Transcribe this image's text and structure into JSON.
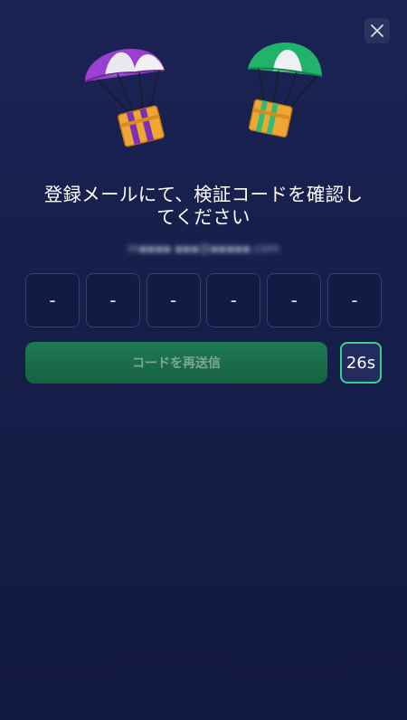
{
  "title_lines": [
    "登録メールにて、検証コードを確認し",
    "てください"
  ],
  "email": "m▪▪▪▪ ▪▪▪@▪▪▪▪▪.com",
  "code_digits": [
    "-",
    "-",
    "-",
    "-",
    "-",
    "-"
  ],
  "resend_label": "コードを再送信",
  "countdown": "26s",
  "icons": [
    "close-icon",
    "parachute-gift-purple-icon",
    "parachute-gift-green-icon"
  ],
  "colors": {
    "accent_green": "#1f7a56",
    "timer_border": "#3ccf8e",
    "background": "#161e4a"
  }
}
